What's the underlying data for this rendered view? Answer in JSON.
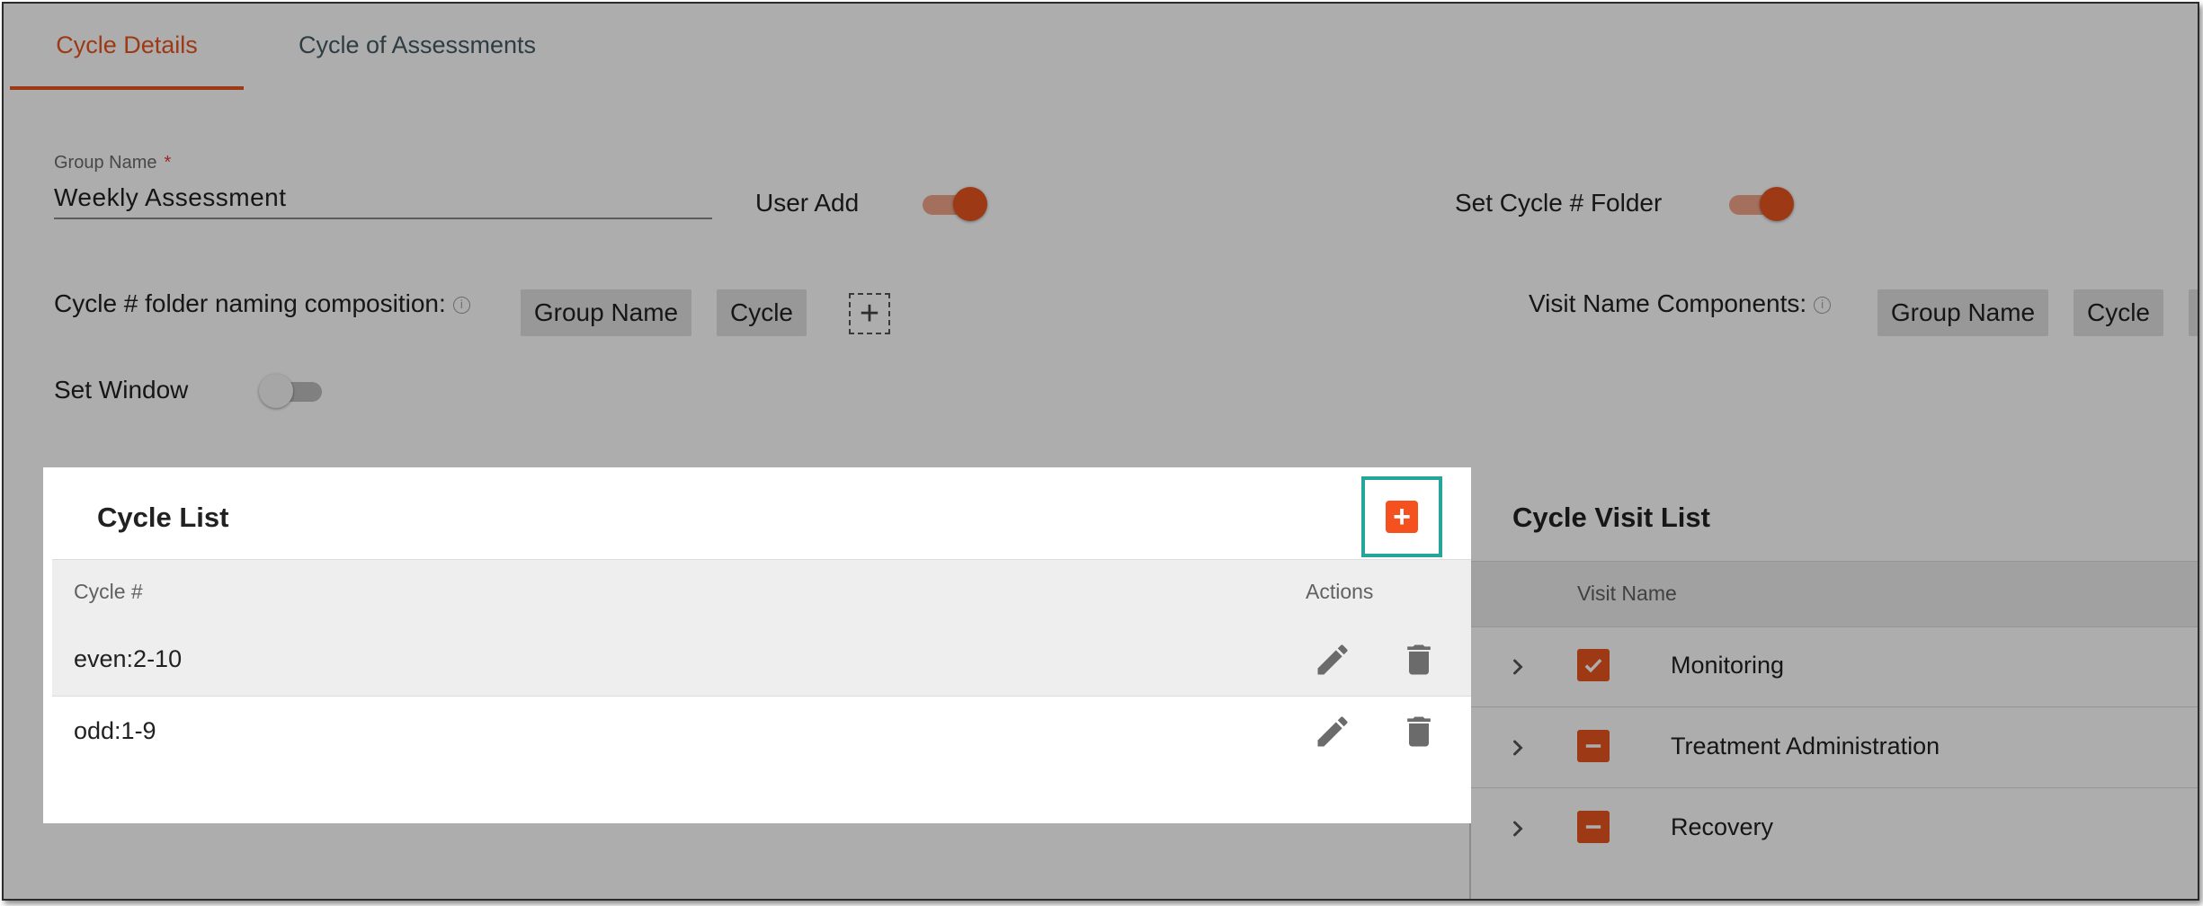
{
  "tabs": [
    {
      "label": "Cycle Details",
      "active": true
    },
    {
      "label": "Cycle of Assessments",
      "active": false
    }
  ],
  "group_name": {
    "label": "Group Name",
    "required_marker": "*",
    "value": "Weekly Assessment"
  },
  "user_add": {
    "label": "User Add",
    "on": true
  },
  "set_cycle_folder": {
    "label": "Set Cycle # Folder",
    "on": true
  },
  "folder_naming": {
    "label": "Cycle # folder naming composition:",
    "info_icon": "info-icon",
    "chips": [
      "Group Name",
      "Cycle"
    ],
    "add_icon": "plus-icon"
  },
  "visit_name_components": {
    "label": "Visit Name Components:",
    "info_icon": "info-icon",
    "chips": [
      "Group Name",
      "Cycle"
    ]
  },
  "set_window": {
    "label": "Set Window",
    "on": false
  },
  "cycle_list": {
    "title": "Cycle List",
    "add_icon": "plus-icon",
    "columns": [
      "Cycle #",
      "Actions"
    ],
    "rows": [
      {
        "cycle": "even:2-10",
        "edit_icon": "pencil-icon",
        "delete_icon": "trash-icon"
      },
      {
        "cycle": "odd:1-9",
        "edit_icon": "pencil-icon",
        "delete_icon": "trash-icon"
      }
    ]
  },
  "cycle_visit_list": {
    "title": "Cycle Visit List",
    "columns": [
      "Visit Name"
    ],
    "rows": [
      {
        "name": "Monitoring",
        "state": "checked",
        "expand_icon": "chevron-right-icon"
      },
      {
        "name": "Treatment Administration",
        "state": "indeterminate",
        "expand_icon": "chevron-right-icon"
      },
      {
        "name": "Recovery",
        "state": "indeterminate",
        "expand_icon": "chevron-right-icon"
      }
    ]
  },
  "colors": {
    "accent": "#e8541e",
    "highlight": "#26a69a"
  }
}
